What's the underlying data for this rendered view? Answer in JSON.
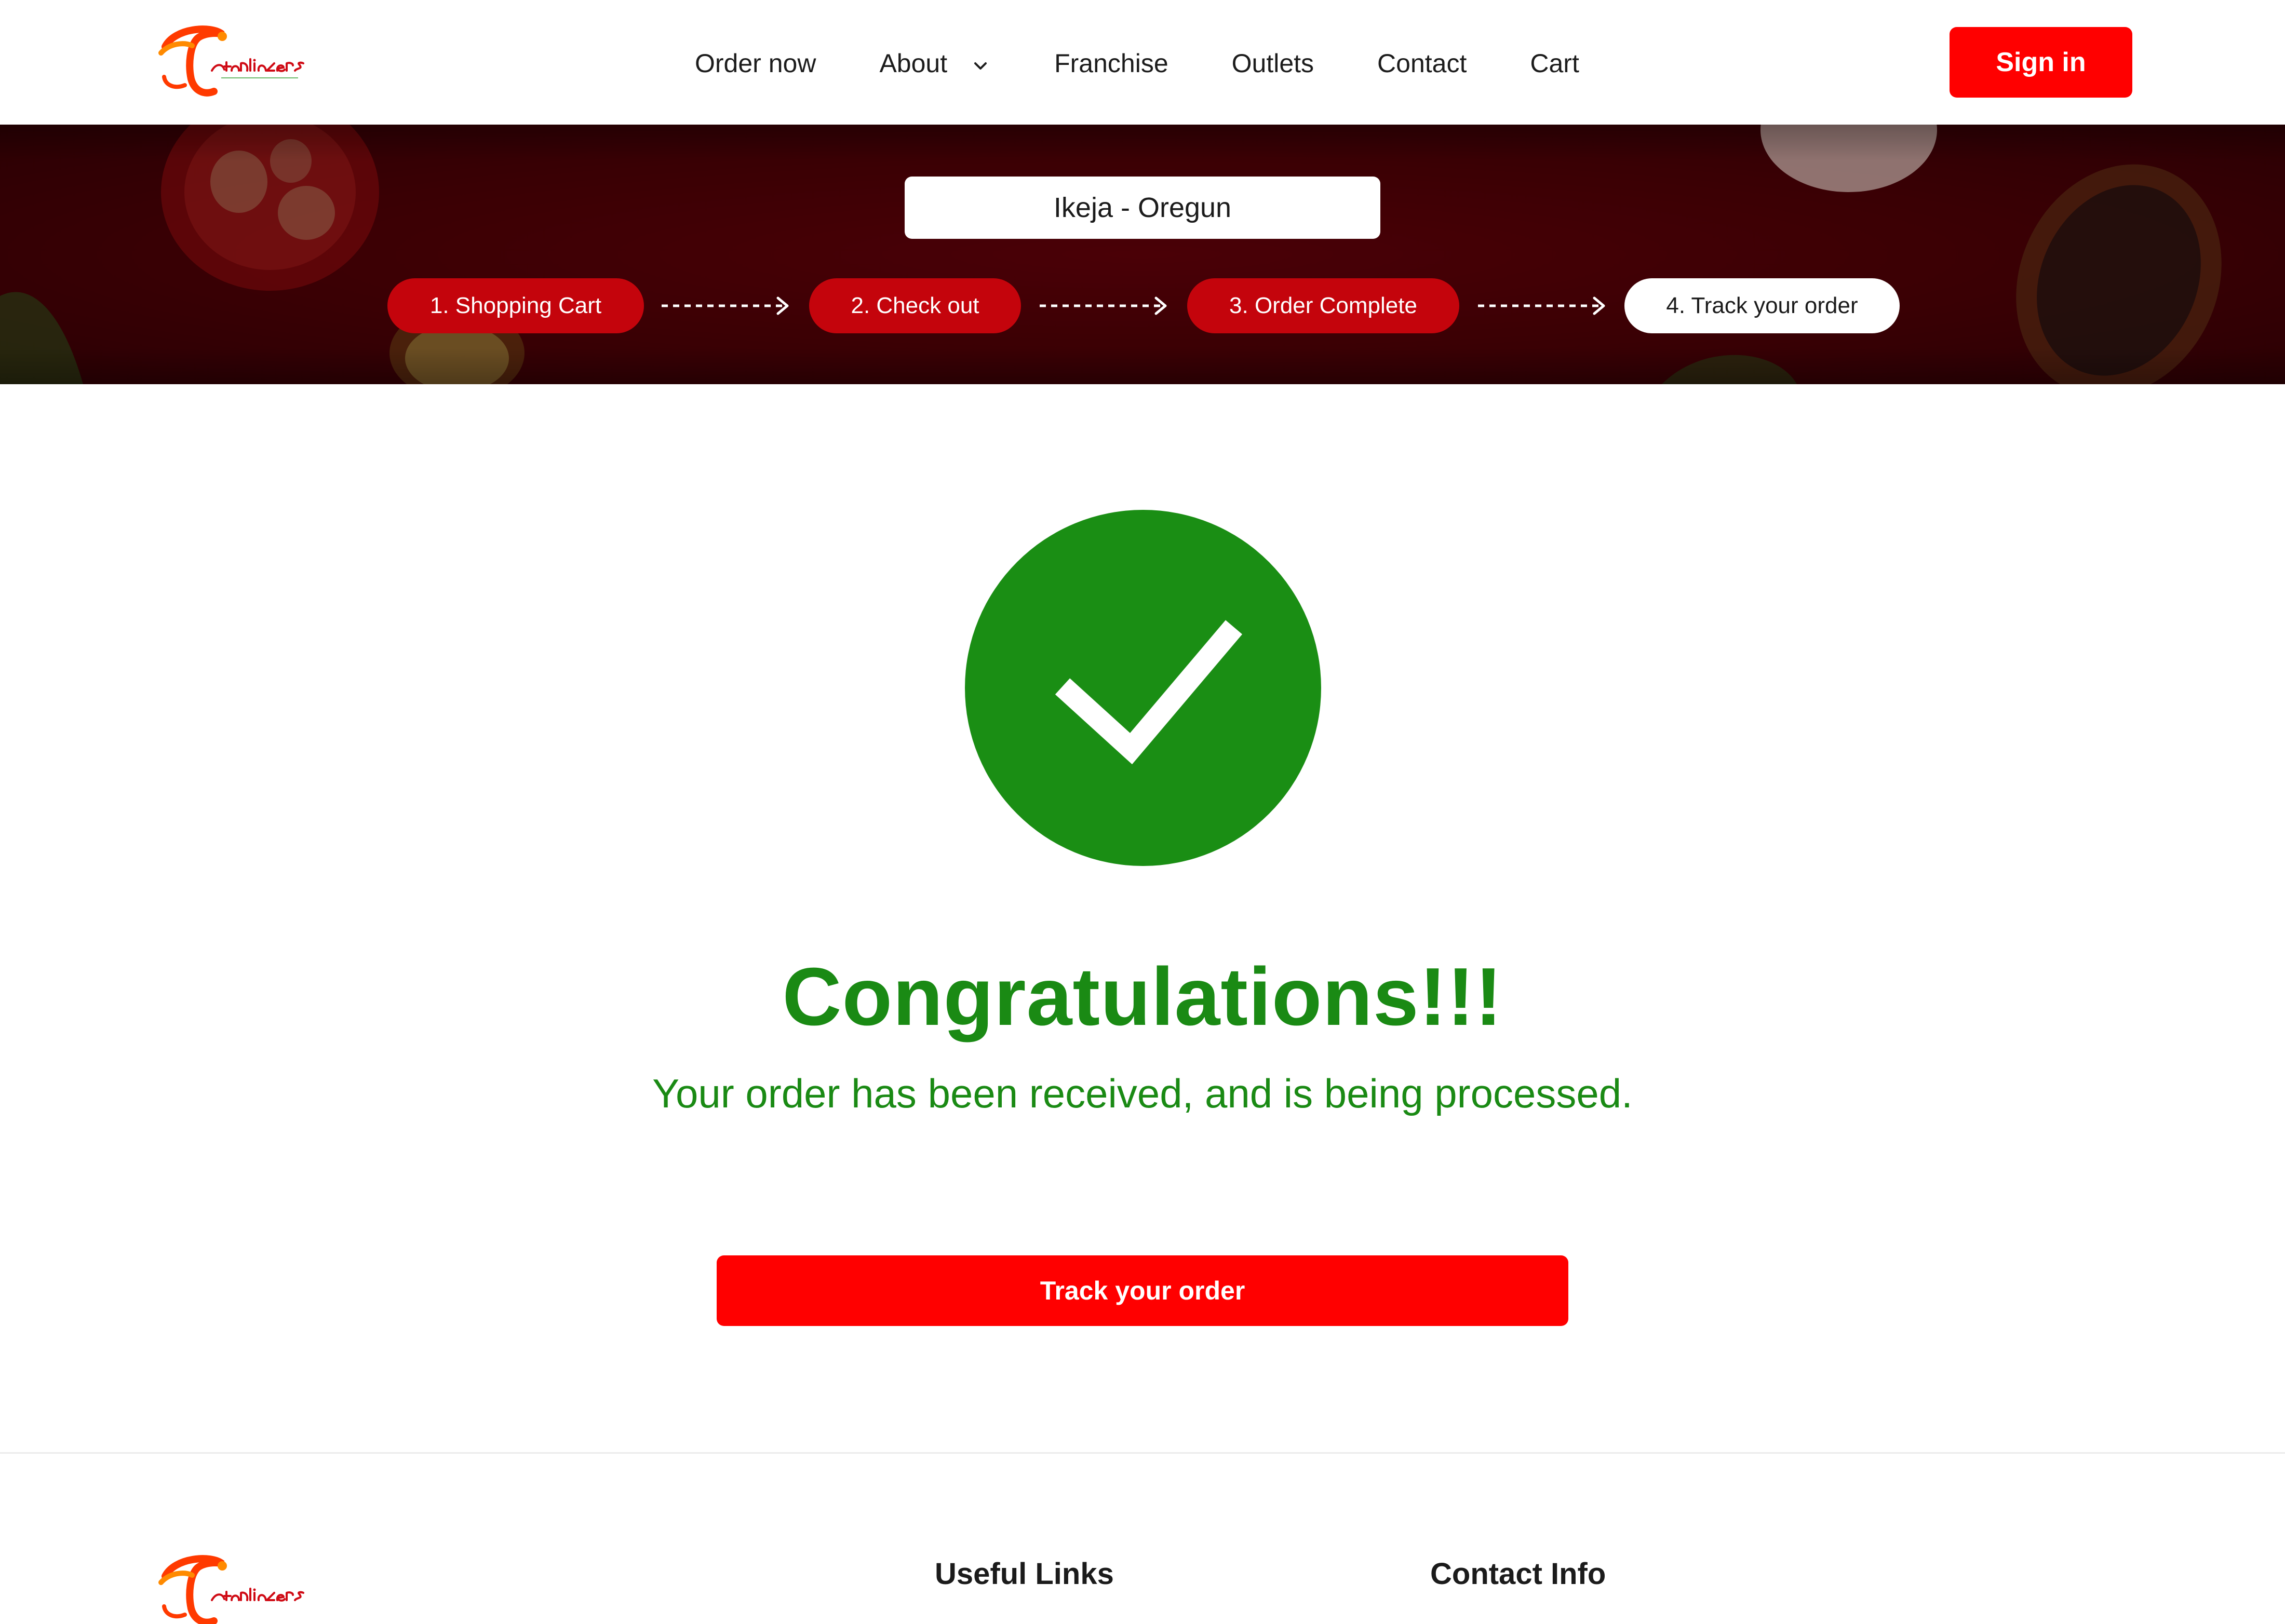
{
  "brand": {
    "name": "Tantalizers",
    "tagline": "every bite, a precious taste",
    "colors": {
      "primary_red": "#ff0000",
      "step_red": "#c4040c",
      "success_green": "#1a8a14",
      "banner_bg": "#3a0004"
    }
  },
  "header": {
    "nav": [
      {
        "label": "Order now"
      },
      {
        "label": "About",
        "has_dropdown": true,
        "icon": "chevron-down-icon"
      },
      {
        "label": "Franchise"
      },
      {
        "label": "Outlets"
      },
      {
        "label": "Contact"
      },
      {
        "label": "Cart"
      }
    ],
    "signin_label": "Sign in"
  },
  "banner": {
    "location": "Ikeja - Oregun",
    "steps": [
      {
        "label": "1. Shopping Cart",
        "state": "done"
      },
      {
        "label": "2. Check out",
        "state": "done"
      },
      {
        "label": "3. Order Complete",
        "state": "done"
      },
      {
        "label": "4. Track your order",
        "state": "current"
      }
    ]
  },
  "main": {
    "status_icon": "check-circle-icon",
    "title": "Congratulations!!!",
    "message": "Your order has been received, and is being processed.",
    "track_button_label": "Track your order"
  },
  "footer": {
    "useful_links_heading": "Useful Links",
    "contact_info_heading": "Contact Info"
  }
}
